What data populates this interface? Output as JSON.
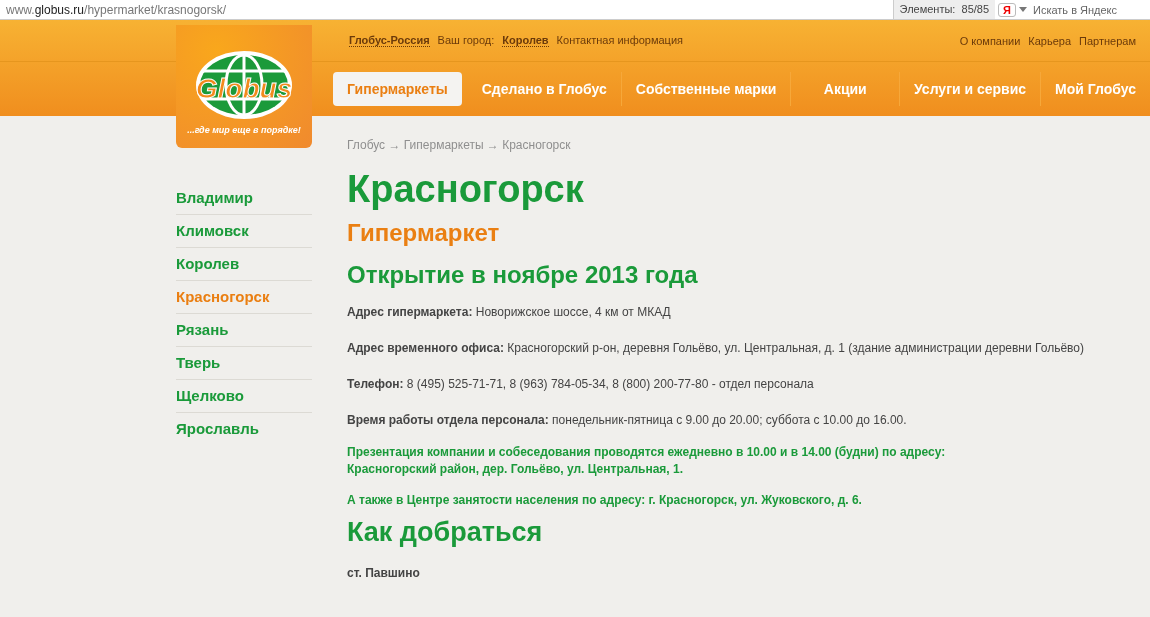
{
  "browser": {
    "url_prefix": "www.",
    "url_domain": "globus.ru",
    "url_path": "/hypermarket/krasnogorsk/",
    "elements_label": "Элементы:",
    "elements_count": "85/85",
    "search_placeholder": "Искать в Яндекс",
    "yandex_letter": "Я"
  },
  "logo": {
    "wordmark": "Globus",
    "slogan": "...где мир еще в порядке!"
  },
  "top_links": {
    "brand": "Глобус-Россия",
    "city_label": "Ваш город:",
    "city": "Королев",
    "contacts": "Контактная информация",
    "right": [
      "О компании",
      "Карьера",
      "Партнерам"
    ]
  },
  "nav": [
    {
      "label": "Гипермаркеты",
      "selected": true
    },
    {
      "label": "Сделано в Глобус",
      "selected": false
    },
    {
      "label": "Собственные марки",
      "selected": false
    },
    {
      "label": "Акции",
      "selected": false
    },
    {
      "label": "Услуги и сервис",
      "selected": false
    },
    {
      "label": "Мой Глобус",
      "selected": false
    }
  ],
  "sidebar": [
    {
      "label": "Владимир",
      "selected": false
    },
    {
      "label": "Климовск",
      "selected": false
    },
    {
      "label": "Королев",
      "selected": false
    },
    {
      "label": "Красногорск",
      "selected": true
    },
    {
      "label": "Рязань",
      "selected": false
    },
    {
      "label": "Тверь",
      "selected": false
    },
    {
      "label": "Щелково",
      "selected": false
    },
    {
      "label": "Ярославль",
      "selected": false
    }
  ],
  "breadcrumb": "Глобус → Гипермаркеты → Красногорск",
  "title": "Красногорск",
  "subtitle": "Гипермаркет",
  "opening": "Открытие в ноябре 2013 года",
  "info": [
    "**Адрес гипермаркета:** Новорижское шоссе, 4 км от МКАД",
    "**Адрес временного офиса:** Красногорский р-он, деревня Гольёво, ул. Центральная, д. 1 (здание администрации деревни Гольёво)",
    "**Телефон:** 8 (495) 525-71-71, 8 (963) 784-05-34, 8 (800) 200-77-80 - отдел персонала",
    "**Время работы отдела персонала:** понедельник-пятница с 9.00 до 20.00; суббота с 10.00 до 16.00."
  ],
  "notices": [
    [
      "Презентация компании и собеседования проводятся ежедневно в 10.00 и в 14.00 (будни) по адресу:",
      "Красногорский район, дер. Гольёво, ул. Центральная, 1."
    ],
    [
      "А также в Центре занятости населения по адресу: г. Красногорск, ул. Жуковского, д. 6."
    ]
  ],
  "directions_title": "Как добраться",
  "station": "ст. Павшино"
}
